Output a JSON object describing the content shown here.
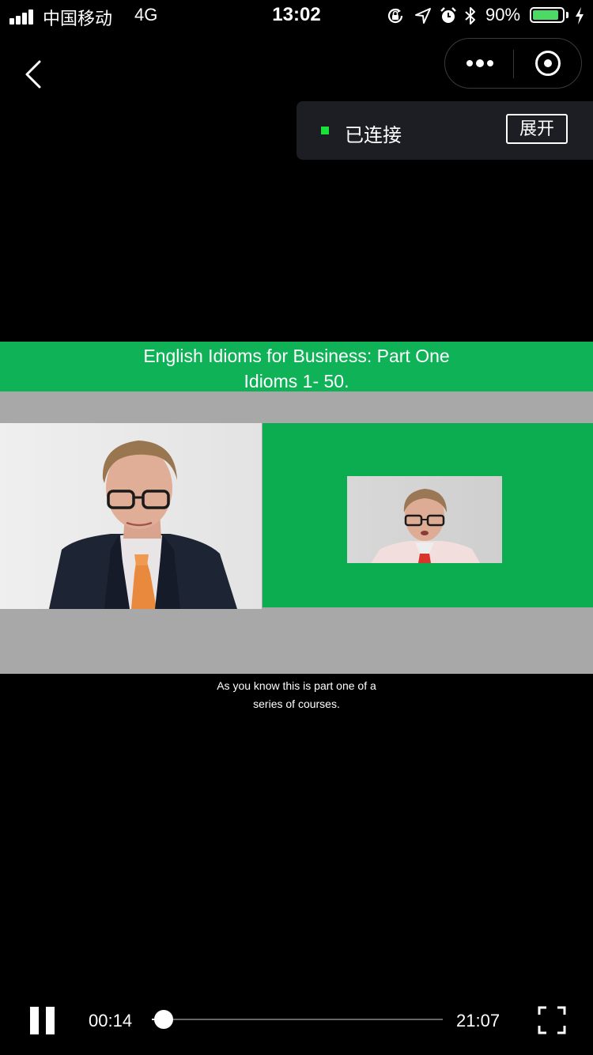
{
  "status_bar": {
    "carrier": "中国移动",
    "network": "4G",
    "time": "13:02",
    "battery_percent": "90%",
    "battery_level": 0.9,
    "icons": [
      "signal-icon",
      "orientation-lock-icon",
      "location-icon",
      "alarm-icon",
      "bluetooth-icon",
      "battery-icon",
      "charging-icon"
    ]
  },
  "nav": {
    "icons": [
      "back-icon",
      "more-icon",
      "close-mini-program-icon"
    ]
  },
  "connection": {
    "status": "已连接",
    "status_color": "#1ae03a",
    "expand_label": "展开"
  },
  "video": {
    "title_line1": "English Idioms for Business: Part One",
    "title_line2": "Idioms 1- 50.",
    "accent_color": "#0fb257",
    "caption_line1": "As you know this is part one of a",
    "caption_line2": "series of courses."
  },
  "player": {
    "current_time": "00:14",
    "total_time": "21:07",
    "progress": 0.011,
    "icons": [
      "pause-icon",
      "fullscreen-icon"
    ]
  }
}
